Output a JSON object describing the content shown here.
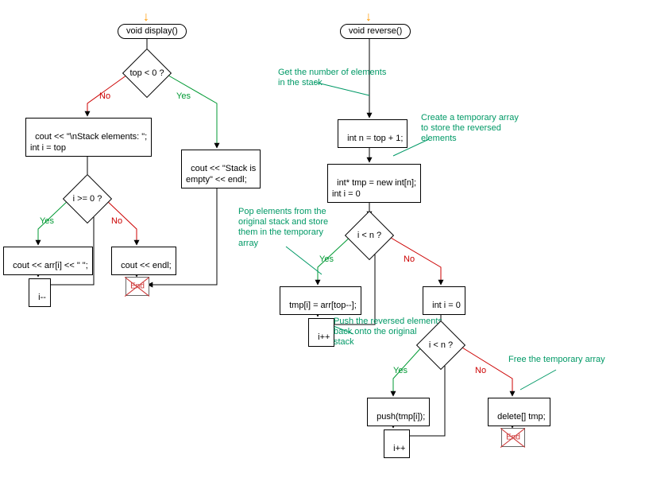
{
  "chart_data": {
    "type": "flowchart",
    "functions": [
      {
        "name": "display",
        "signature": "void display()",
        "nodes": [
          {
            "id": "d_start",
            "kind": "function",
            "label": "void display()"
          },
          {
            "id": "d_cond1",
            "kind": "decision",
            "label": "top < 0 ?"
          },
          {
            "id": "d_empty",
            "kind": "process",
            "label": "cout << \"Stack is\\nempty\" << endl;"
          },
          {
            "id": "d_header",
            "kind": "process",
            "label": "cout << \"\\nStack elements: \";\\nint i = top"
          },
          {
            "id": "d_cond2",
            "kind": "decision",
            "label": "i >= 0 ?"
          },
          {
            "id": "d_print",
            "kind": "process",
            "label": "cout << arr[i] << \" \";"
          },
          {
            "id": "d_dec",
            "kind": "process",
            "label": "i--"
          },
          {
            "id": "d_endl",
            "kind": "process",
            "label": "cout << endl;"
          },
          {
            "id": "d_end",
            "kind": "terminator",
            "label": "End"
          }
        ],
        "edges": [
          {
            "from": "d_start",
            "to": "d_cond1"
          },
          {
            "from": "d_cond1",
            "to": "d_empty",
            "label": "Yes"
          },
          {
            "from": "d_cond1",
            "to": "d_header",
            "label": "No"
          },
          {
            "from": "d_header",
            "to": "d_cond2"
          },
          {
            "from": "d_cond2",
            "to": "d_print",
            "label": "Yes"
          },
          {
            "from": "d_print",
            "to": "d_dec"
          },
          {
            "from": "d_dec",
            "to": "d_cond2"
          },
          {
            "from": "d_cond2",
            "to": "d_endl",
            "label": "No"
          },
          {
            "from": "d_empty",
            "to": "d_end"
          },
          {
            "from": "d_endl",
            "to": "d_end"
          }
        ]
      },
      {
        "name": "reverse",
        "signature": "void reverse()",
        "annotations": {
          "ann_get": "Get the number of elements\nin the stack",
          "ann_tmp": "Create a temporary array\nto store the reversed\nelements",
          "ann_pop": "Pop elements from the\noriginal stack and store\nthem in the temporary\narray",
          "ann_push": "Push the reversed elements\nback onto the original\nstack",
          "ann_free": "Free the temporary array"
        },
        "nodes": [
          {
            "id": "r_start",
            "kind": "function",
            "label": "void reverse()"
          },
          {
            "id": "r_n",
            "kind": "process",
            "label": "int n = top + 1;"
          },
          {
            "id": "r_tmp",
            "kind": "process",
            "label": "int* tmp = new int[n];\\nint i = 0"
          },
          {
            "id": "r_cond1",
            "kind": "decision",
            "label": "i < n ?"
          },
          {
            "id": "r_pop",
            "kind": "process",
            "label": "tmp[i] = arr[top--];"
          },
          {
            "id": "r_inc1",
            "kind": "process",
            "label": "i++"
          },
          {
            "id": "r_reset",
            "kind": "process",
            "label": "int i = 0"
          },
          {
            "id": "r_cond2",
            "kind": "decision",
            "label": "i < n ?"
          },
          {
            "id": "r_push",
            "kind": "process",
            "label": "push(tmp[i]);"
          },
          {
            "id": "r_inc2",
            "kind": "process",
            "label": "i++"
          },
          {
            "id": "r_del",
            "kind": "process",
            "label": "delete[] tmp;"
          },
          {
            "id": "r_end",
            "kind": "terminator",
            "label": "End"
          }
        ],
        "edges": [
          {
            "from": "r_start",
            "to": "r_n"
          },
          {
            "from": "r_n",
            "to": "r_tmp"
          },
          {
            "from": "r_tmp",
            "to": "r_cond1"
          },
          {
            "from": "r_cond1",
            "to": "r_pop",
            "label": "Yes"
          },
          {
            "from": "r_pop",
            "to": "r_inc1"
          },
          {
            "from": "r_inc1",
            "to": "r_cond1"
          },
          {
            "from": "r_cond1",
            "to": "r_reset",
            "label": "No"
          },
          {
            "from": "r_reset",
            "to": "r_cond2"
          },
          {
            "from": "r_cond2",
            "to": "r_push",
            "label": "Yes"
          },
          {
            "from": "r_push",
            "to": "r_inc2"
          },
          {
            "from": "r_inc2",
            "to": "r_cond2"
          },
          {
            "from": "r_cond2",
            "to": "r_del",
            "label": "No"
          },
          {
            "from": "r_del",
            "to": "r_end"
          }
        ]
      }
    ]
  },
  "labels": {
    "display_func": "void display()",
    "display_cond1": "top < 0 ?",
    "display_empty": "cout << \"Stack is\nempty\" << endl;",
    "display_header": "cout << \"\\nStack elements: \";\nint i = top",
    "display_cond2": "i >= 0 ?",
    "display_print": "cout << arr[i] << \" \";",
    "display_dec": "i--",
    "display_endl": "cout << endl;",
    "reverse_func": "void reverse()",
    "reverse_n": "int n = top + 1;",
    "reverse_tmp": "int* tmp = new int[n];\nint i = 0",
    "reverse_cond1": "i < n ?",
    "reverse_pop": "tmp[i] = arr[top--];",
    "reverse_inc1": "i++",
    "reverse_reset": "int i = 0",
    "reverse_cond2": "i < n ?",
    "reverse_push": "push(tmp[i]);",
    "reverse_inc2": "i++",
    "reverse_del": "delete[] tmp;",
    "end": "End",
    "yes": "Yes",
    "no": "No",
    "ann_get": "Get the number of elements\nin the stack",
    "ann_tmp": "Create a temporary array\nto store the reversed\nelements",
    "ann_pop": "Pop elements from the\noriginal stack and store\nthem in the temporary\narray",
    "ann_push": "Push the reversed elements\nback onto the original\nstack",
    "ann_free": "Free the temporary array"
  }
}
